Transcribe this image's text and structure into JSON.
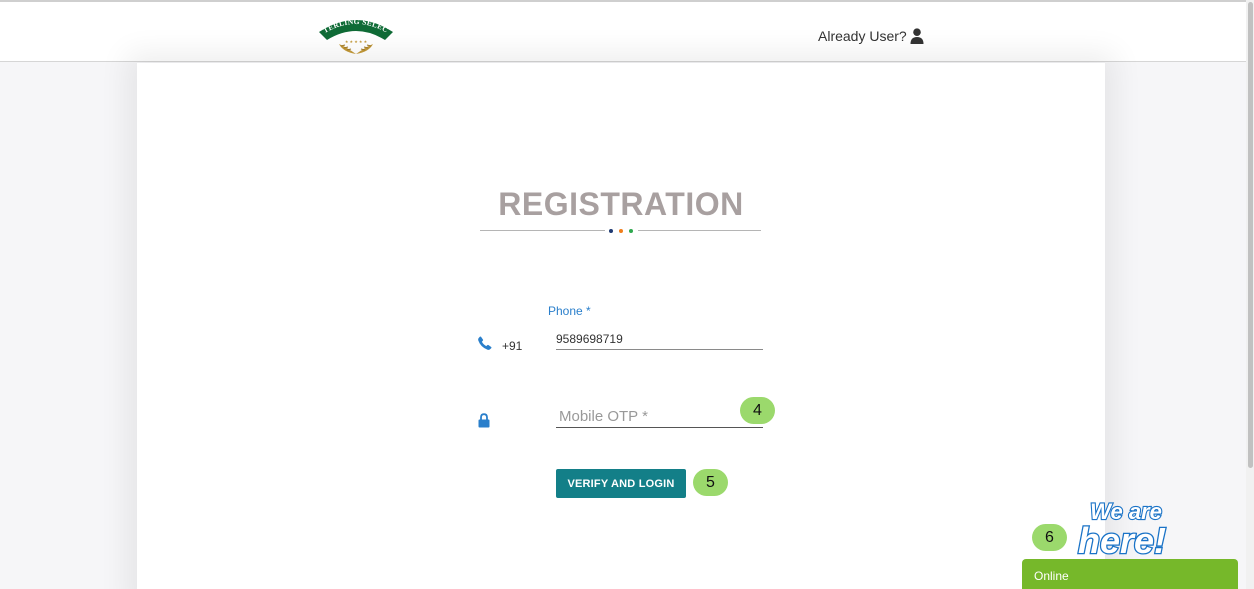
{
  "header": {
    "logo_text": "STERLING SELECT",
    "already_user_label": "Already User?"
  },
  "registration": {
    "title": "REGISTRATION",
    "divider_dot_colors": [
      "#1f3a73",
      "#f07e1c",
      "#2fa84f"
    ],
    "phone_label": "Phone *",
    "country_code": "+91",
    "phone_value": "9589698719",
    "otp_placeholder": "Mobile OTP *",
    "verify_button_label": "VERIFY AND LOGIN"
  },
  "annotations": {
    "badge_4": "4",
    "badge_5": "5",
    "badge_6": "6"
  },
  "chat_widget": {
    "tagline_line1": "We are",
    "tagline_line2": "here!",
    "status_label": "Online",
    "status_color": "#76b82a"
  },
  "colors": {
    "accent_teal": "#137f88",
    "label_blue": "#2a7fcb",
    "title_gray": "#a8a0a0",
    "badge_green": "#9bd96c"
  }
}
